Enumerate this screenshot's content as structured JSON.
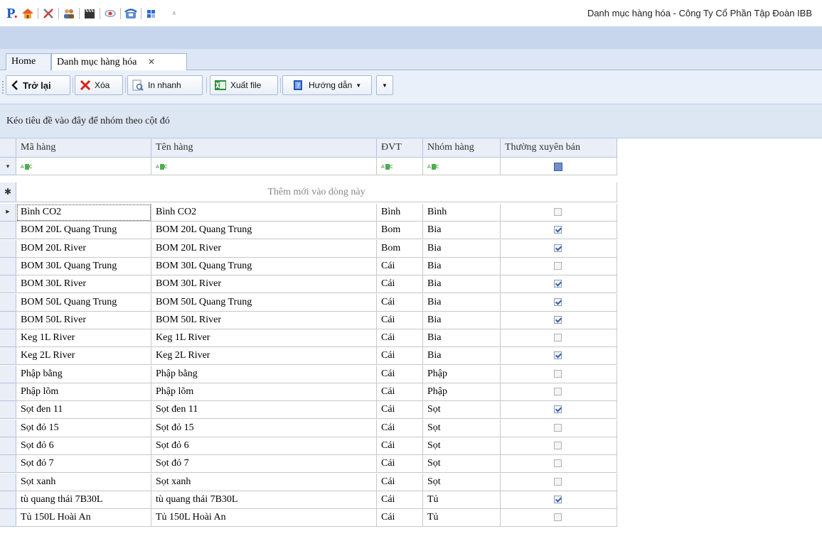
{
  "window": {
    "title": "Danh mục hàng hóa - Công Ty Cổ Phần Tập Đoàn IBB",
    "qat_icons": [
      "app-logo",
      "home-icon",
      "tools-icon",
      "users-icon",
      "clapper-icon",
      "eye-icon",
      "phone-icon",
      "windows-icon",
      "customize-arrow-icon"
    ]
  },
  "tabs": [
    {
      "label": "Home"
    },
    {
      "label": "Danh mục hàng hóa",
      "close": "✕"
    }
  ],
  "toolbar": {
    "back": "Trở lại",
    "delete": "Xóa",
    "print": "In nhanh",
    "export": "Xuất file",
    "guide": "Hướng dẫn"
  },
  "group_panel": {
    "hint": "Kéo tiêu đề vào đây để nhóm theo cột đó"
  },
  "grid": {
    "columns": [
      "Mã hàng",
      "Tên hàng",
      "ĐVT",
      "Nhóm hàng",
      "Thường xuyên bán"
    ],
    "new_row_text": "Thêm mới vào dòng này",
    "rows": [
      {
        "ma": "Bình CO2",
        "ten": "Bình CO2",
        "dvt": "Bình",
        "nhom": "Bình",
        "txb": false
      },
      {
        "ma": "BOM 20L Quang Trung",
        "ten": "BOM 20L Quang Trung",
        "dvt": "Bom",
        "nhom": "Bia",
        "txb": true
      },
      {
        "ma": "BOM 20L River",
        "ten": "BOM 20L River",
        "dvt": "Bom",
        "nhom": "Bia",
        "txb": true
      },
      {
        "ma": "BOM 30L Quang Trung",
        "ten": "BOM 30L Quang Trung",
        "dvt": "Cái",
        "nhom": "Bia",
        "txb": false
      },
      {
        "ma": "BOM 30L River",
        "ten": "BOM 30L River",
        "dvt": "Cái",
        "nhom": "Bia",
        "txb": true
      },
      {
        "ma": "BOM 50L Quang Trung",
        "ten": "BOM 50L Quang Trung",
        "dvt": "Cái",
        "nhom": "Bia",
        "txb": true
      },
      {
        "ma": "BOM 50L River",
        "ten": "BOM 50L River",
        "dvt": "Cái",
        "nhom": "Bia",
        "txb": true
      },
      {
        "ma": "Keg 1L River",
        "ten": "Keg 1L River",
        "dvt": "Cái",
        "nhom": "Bia",
        "txb": false
      },
      {
        "ma": "Keg 2L River",
        "ten": "Keg 2L River",
        "dvt": "Cái",
        "nhom": "Bia",
        "txb": true
      },
      {
        "ma": "Phập bằng",
        "ten": "Phập bằng",
        "dvt": "Cái",
        "nhom": "Phập",
        "txb": false
      },
      {
        "ma": "Phập lõm",
        "ten": "Phập lõm",
        "dvt": "Cái",
        "nhom": "Phập",
        "txb": false
      },
      {
        "ma": "Sọt đen 11",
        "ten": "Sọt đen 11",
        "dvt": "Cái",
        "nhom": "Sọt",
        "txb": true
      },
      {
        "ma": "Sọt đỏ 15",
        "ten": "Sọt đỏ 15",
        "dvt": "Cái",
        "nhom": "Sọt",
        "txb": false
      },
      {
        "ma": "Sọt đỏ 6",
        "ten": "Sọt đỏ 6",
        "dvt": "Cái",
        "nhom": "Sọt",
        "txb": false
      },
      {
        "ma": "Sọt đỏ 7",
        "ten": "Sọt đỏ 7",
        "dvt": "Cái",
        "nhom": "Sọt",
        "txb": false
      },
      {
        "ma": "Sọt xanh",
        "ten": "Sọt xanh",
        "dvt": "Cái",
        "nhom": "Sọt",
        "txb": false
      },
      {
        "ma": "tù  quang thái 7B30L",
        "ten": "tù  quang thái 7B30L",
        "dvt": "Cái",
        "nhom": "Tủ",
        "txb": true
      },
      {
        "ma": "Tủ 150L Hoài An",
        "ten": "Tủ 150L Hoài An",
        "dvt": "Cái",
        "nhom": "Tủ",
        "txb": false
      }
    ]
  },
  "colors": {
    "accent": "#1b56b8",
    "ribbon": "#c7d6ec",
    "header": "#e9eef7"
  }
}
